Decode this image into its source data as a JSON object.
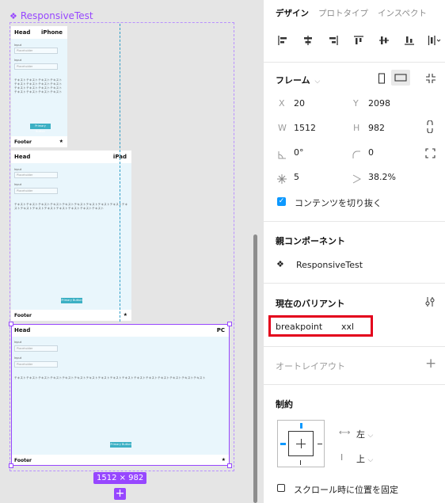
{
  "canvas": {
    "component_title": "ResponsiveTest",
    "frames": [
      {
        "header_left": "Head",
        "header_right": "iPhone",
        "input_label_1": "Input",
        "input_placeholder_1": "Placeholder",
        "input_label_2": "Input",
        "input_placeholder_2": "Placeholder",
        "body_text": "テキストテキストテキストテキストテキストテキストテキストテキストテキストテキストテキストテキストテキストテキストテキストテキストテキスト",
        "button": "Primary Button",
        "footer_left": "Footer",
        "footer_right": "★"
      },
      {
        "header_left": "Head",
        "header_right": "iPad",
        "input_label_1": "Input",
        "input_placeholder_1": "Placeholder",
        "input_label_2": "Input",
        "input_placeholder_2": "Placeholder",
        "body_text": "テキストテキストテキストテキストテキストテキストテキストテキストテキストテキストテキストテキストテキストテキストテキストテキストテキスト",
        "button": "Primary Button",
        "footer_left": "Footer",
        "footer_right": "★"
      },
      {
        "header_left": "Head",
        "header_right": "PC",
        "input_label_1": "Input",
        "input_placeholder_1": "Placeholder",
        "input_label_2": "Input",
        "input_placeholder_2": "Placeholder",
        "body_text": "テキストテキストテキストテキストテキストテキストテキストテキストテキストテキストテキストテキストテキストテキストテキストテキスト",
        "button": "Primary Button",
        "footer_left": "Footer",
        "footer_right": "★"
      }
    ],
    "selection_size": "1512 × 982",
    "add_symbol": "+"
  },
  "panel": {
    "tabs": [
      "デザイン",
      "プロトタイプ",
      "インスペクト"
    ],
    "frame": {
      "title": "フレーム",
      "x_label": "X",
      "x": "20",
      "y_label": "Y",
      "y": "2098",
      "w_label": "W",
      "w": "1512",
      "h_label": "H",
      "h": "982",
      "rotation": "0°",
      "radius": "0",
      "corner_smoothing": "5",
      "opacity": "38.2%",
      "clip_content": "コンテンツを切り抜く"
    },
    "parent_component": {
      "title": "親コンポーネント",
      "name": "ResponsiveTest"
    },
    "current_variant": {
      "title": "現在のバリアント",
      "property": "breakpoint",
      "value": "xxl"
    },
    "auto_layout": {
      "title": "オートレイアウト",
      "add": "+"
    },
    "constraints": {
      "title": "制約",
      "horizontal": "左",
      "vertical": "上"
    },
    "fix_scroll": "スクロール時に位置を固定"
  },
  "colors": {
    "accent": "#9747ff",
    "selection_blue": "#0d99ff",
    "highlight": "#e3001b"
  }
}
